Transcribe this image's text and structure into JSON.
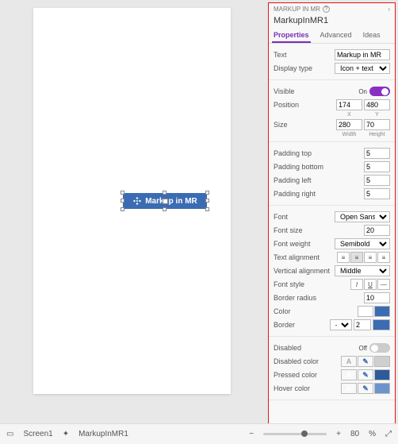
{
  "header": {
    "breadcrumb": "MARKUP IN MR",
    "control_name": "MarkupInMR1"
  },
  "tabs": [
    "Properties",
    "Advanced",
    "Ideas"
  ],
  "props": {
    "text_label": "Text",
    "text_value": "Markup in MR",
    "display_type_label": "Display type",
    "display_type_value": "Icon + text",
    "visible_label": "Visible",
    "visible_on": "On",
    "position_label": "Position",
    "pos_x": "174",
    "pos_y": "480",
    "x_lbl": "X",
    "y_lbl": "Y",
    "size_label": "Size",
    "width": "280",
    "height": "70",
    "w_lbl": "Width",
    "h_lbl": "Height",
    "pad_top_label": "Padding top",
    "pad_top": "5",
    "pad_bottom_label": "Padding bottom",
    "pad_bottom": "5",
    "pad_left_label": "Padding left",
    "pad_left": "5",
    "pad_right_label": "Padding right",
    "pad_right": "5",
    "font_label": "Font",
    "font_value": "Open Sans",
    "font_size_label": "Font size",
    "font_size": "20",
    "font_weight_label": "Font weight",
    "font_weight": "Semibold",
    "text_align_label": "Text alignment",
    "vert_align_label": "Vertical alignment",
    "vert_align": "Middle",
    "font_style_label": "Font style",
    "border_radius_label": "Border radius",
    "border_radius": "10",
    "color_label": "Color",
    "border_label": "Border",
    "border_width": "2",
    "disabled_label": "Disabled",
    "disabled_off": "Off",
    "disabled_color_label": "Disabled color",
    "pressed_color_label": "Pressed color",
    "hover_color_label": "Hover color"
  },
  "colors": {
    "accent": "#3b6cb3",
    "white": "#ffffff",
    "blue": "#3b6cb3",
    "dblue": "#2f5a99",
    "lblue": "#6d93cc",
    "gray": "#cfcfcf",
    "dgray": "#7a7a7a"
  },
  "statusbar": {
    "screen": "Screen1",
    "control": "MarkupInMR1",
    "zoom": "80",
    "pct": "%"
  },
  "canvas_button": {
    "label": "Markup in MR"
  }
}
